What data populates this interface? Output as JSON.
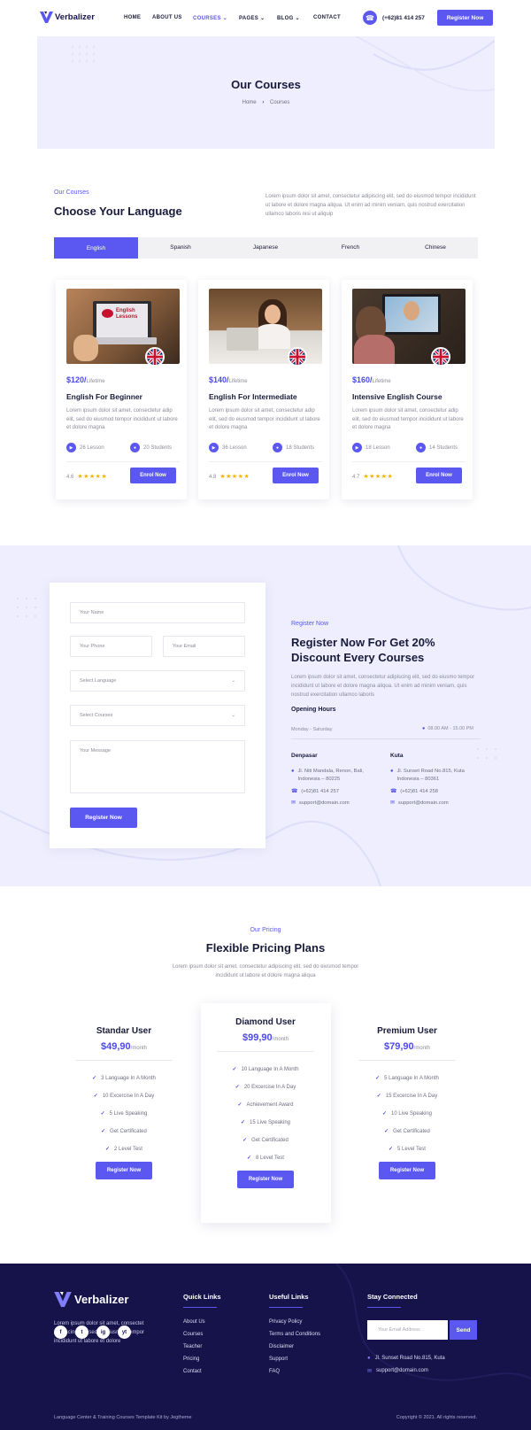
{
  "header": {
    "brand": "Verbalizer",
    "nav": [
      "HOME",
      "ABOUT US",
      "COURSES",
      "PAGES",
      "BLOG",
      "CONTACT"
    ],
    "phone": "(+62)81 414 257",
    "cta": "Register Now"
  },
  "hero": {
    "title": "Our Courses",
    "breadcrumb_home": "Home",
    "breadcrumb_current": "Courses"
  },
  "courses_section": {
    "eyebrow": "Our Courses",
    "title": "Choose Your Language",
    "intro": "Lorem ipsum dolor sit amet, consectetur adipiscing elit, sed do eiusmod tempor incididunt ut labore et dolore magna aliqua. Ut enim ad minim veniam, quis nostrud exercitation ullamco laboris nisi ut aliquip",
    "tabs": [
      "English",
      "Spanish",
      "Japanese",
      "French",
      "Chinese"
    ],
    "cards": [
      {
        "price": "$120/",
        "period": "Lifetime",
        "title": "English For Beginner",
        "desc": "Lorem ipsum dolor sit amet, consectetur adip elit, sed do eiusmod tempor incididunt ut labore et dolore magna",
        "lessons": "26 Lesson",
        "students": "20 Students",
        "rating": "4.6",
        "stars": "★★★★★",
        "button": "Enrol Now",
        "thumb_text": "English Lessons"
      },
      {
        "price": "$140/",
        "period": "Lifetime",
        "title": "English For Intermediate",
        "desc": "Lorem ipsum dolor sit amet, consectetur adip elit, sed do eiusmod tempor incididunt ut labore et dolore magna",
        "lessons": "36 Lesson",
        "students": "18 Students",
        "rating": "4.8",
        "stars": "★★★★★",
        "button": "Enrol Now"
      },
      {
        "price": "$160/",
        "period": "Lifetime",
        "title": "Intensive English Course",
        "desc": "Lorem ipsum dolor sit amet, consectetur adip elit, sed do eiusmod tempor incididunt ut labore et dolore magna",
        "lessons": "18 Lesson",
        "students": "14 Students",
        "rating": "4.7",
        "stars": "★★★★★",
        "button": "Enrol Now"
      }
    ]
  },
  "register": {
    "form": {
      "name_ph": "Your Name",
      "phone_ph": "Your Phone",
      "email_ph": "Your Email",
      "language_ph": "Select Language",
      "courses_ph": "Select Courses",
      "message_ph": "Your Message",
      "submit": "Register Now"
    },
    "eyebrow": "Register Now",
    "title": "Register Now For Get 20% Discount Every Courses",
    "text": "Lorem ipsum dolor sit amet, consectetur adipiscing elit, sed do eiusmo tempor incididunt ut labore et dolore magna aliqua. Ut enim ad minim veniam, quis nostrud exercitation ullamco laboris",
    "hours_title": "Opening Hours",
    "days": "Monday - Saturday",
    "time": "08.00 AM - 15.00 PM",
    "offices": [
      {
        "city": "Denpasar",
        "address": "Jl. Niti Mandala, Renon, Bali, Indonesia – 80225",
        "phone": "(+62)81 414 257",
        "email": "support@domain.com"
      },
      {
        "city": "Kuta",
        "address": "Jl. Sunset Road No.815, Kuta Indonesia – 80361",
        "phone": "(+62)81 414 258",
        "email": "support@domain.com"
      }
    ]
  },
  "pricing": {
    "eyebrow": "Our Pricing",
    "title": "Flexible Pricing Plans",
    "intro": "Lorem ipsum dolor sit amet, consectetur adipiscing elit, sed do eiusmod tempor incididunt ut labore et dolore magna aliqua",
    "plans": [
      {
        "name": "Standar User",
        "price": "$49,90",
        "per": "/month",
        "features": [
          "3 Language In A Month",
          "10 Excercise In A Day",
          "5 Live Speaking",
          "Get Certificated",
          "2 Level Test"
        ],
        "button": "Register Now"
      },
      {
        "name": "Diamond User",
        "price": "$99,90",
        "per": "/month",
        "features": [
          "10 Language In A Month",
          "20 Excercise In A Day",
          "Achievement Award",
          "15 Live Speaking",
          "Get Certificated",
          "8 Level Test"
        ],
        "button": "Register Now"
      },
      {
        "name": "Premium User",
        "price": "$79,90",
        "per": "/month",
        "features": [
          "5 Language In A Month",
          "15 Excercise In A Day",
          "10 Live Speaking",
          "Get Certificated",
          "5 Level Test"
        ],
        "button": "Register Now"
      }
    ]
  },
  "footer": {
    "brand": "Verbalizer",
    "about": "Lorem ipsum dolor sit amet, consectet adipiscing elit, sed do eiusmod tempor incididunt ut labore et dolore",
    "quick_title": "Quick Links",
    "quick_links": [
      "About Us",
      "Courses",
      "Teacher",
      "Pricing",
      "Contact"
    ],
    "useful_title": "Useful Links",
    "useful_links": [
      "Privacy Policy",
      "Terms and Conditions",
      "Disclaimer",
      "Support",
      "FAQ"
    ],
    "stay_title": "Stay Connected",
    "email_ph": "Your Email Address",
    "send": "Send",
    "address": "Jl. Sunset Road No.815, Kuta",
    "email": "support@domain.com",
    "social": [
      "f",
      "t",
      "ig",
      "yt"
    ],
    "credit": "Language Center & Training Courses Template Kit by Jegtheme",
    "copyright": "Copyright © 2021. All rights reserved."
  },
  "colors": {
    "accent": "#5a58f0",
    "hero_bg": "#eeeefe",
    "footer_bg": "#15134a"
  }
}
